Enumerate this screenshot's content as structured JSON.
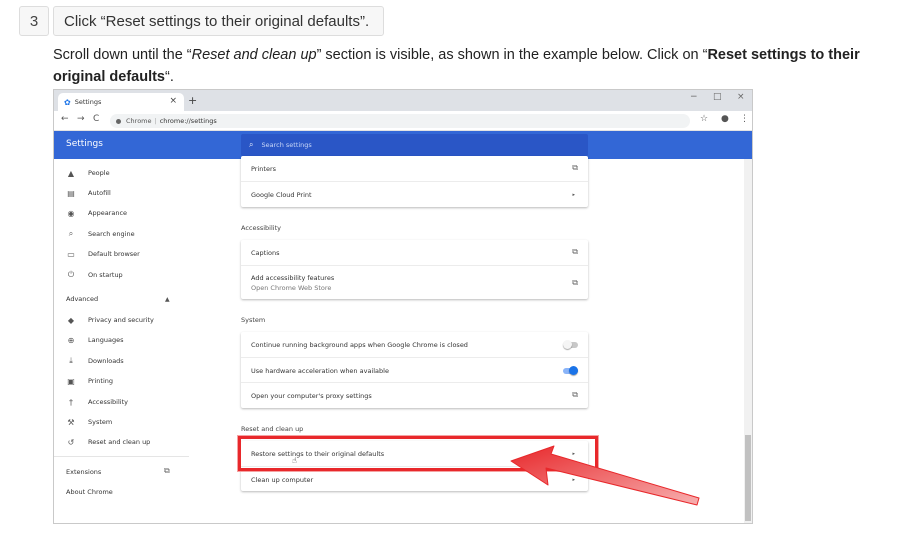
{
  "step": {
    "number": "3",
    "title": "Click “Reset settings to their original defaults”."
  },
  "instructions": {
    "part1": "Scroll down until the “",
    "em": "Reset and clean up",
    "part2": "” section is visible, as shown in the example below. Click on “",
    "strong": "Reset settings to their original defaults",
    "part3": "“."
  },
  "screenshot": {
    "tab": {
      "title": "Settings",
      "close": "×",
      "new_tab": "+"
    },
    "window_controls": {
      "minimize": "−",
      "maximize": "□",
      "close": "×"
    },
    "nav": {
      "back": "←",
      "forward": "→",
      "reload": "C"
    },
    "address": {
      "site": "Chrome",
      "path": "chrome://settings"
    },
    "toolbar_icons": {
      "bookmark": "☆",
      "profile": "●",
      "menu": "⋮"
    },
    "header": {
      "title": "Settings",
      "search_placeholder": "Search settings"
    },
    "sidebar": {
      "items": [
        {
          "icon": "person-icon",
          "glyph": "▲",
          "label": "People"
        },
        {
          "icon": "autofill-icon",
          "glyph": "▤",
          "label": "Autofill"
        },
        {
          "icon": "palette-icon",
          "glyph": "◉",
          "label": "Appearance"
        },
        {
          "icon": "search-icon",
          "glyph": "⌕",
          "label": "Search engine"
        },
        {
          "icon": "browser-icon",
          "glyph": "▭",
          "label": "Default browser"
        },
        {
          "icon": "power-icon",
          "glyph": "⏻",
          "label": "On startup"
        }
      ],
      "advanced_label": "Advanced",
      "advanced_chevron": "▲",
      "advanced_items": [
        {
          "icon": "shield-icon",
          "glyph": "◆",
          "label": "Privacy and security"
        },
        {
          "icon": "globe-icon",
          "glyph": "⊕",
          "label": "Languages"
        },
        {
          "icon": "download-icon",
          "glyph": "⤓",
          "label": "Downloads"
        },
        {
          "icon": "printer-icon",
          "glyph": "▣",
          "label": "Printing"
        },
        {
          "icon": "accessibility-icon",
          "glyph": "†",
          "label": "Accessibility"
        },
        {
          "icon": "wrench-icon",
          "glyph": "⚒",
          "label": "System"
        },
        {
          "icon": "history-icon",
          "glyph": "↺",
          "label": "Reset and clean up"
        }
      ],
      "extensions_label": "Extensions",
      "extensions_icon": "⧉",
      "about_label": "About Chrome"
    },
    "main": {
      "printing_rows": [
        {
          "label": "Printers",
          "action": "⧉"
        },
        {
          "label": "Google Cloud Print",
          "action": "▸"
        }
      ],
      "accessibility_title": "Accessibility",
      "accessibility_rows": [
        {
          "label": "Captions",
          "action": "⧉"
        },
        {
          "label": "Add accessibility features",
          "sublabel": "Open Chrome Web Store",
          "action": "⧉"
        }
      ],
      "system_title": "System",
      "system_rows": [
        {
          "label": "Continue running background apps when Google Chrome is closed",
          "toggle": false
        },
        {
          "label": "Use hardware acceleration when available",
          "toggle": true
        },
        {
          "label": "Open your computer's proxy settings",
          "action": "⧉"
        }
      ],
      "reset_title": "Reset and clean up",
      "reset_rows": [
        {
          "label": "Restore settings to their original defaults",
          "action": "▸"
        },
        {
          "label": "Clean up computer",
          "action": "▸"
        }
      ]
    },
    "colors": {
      "header": "#3367d6",
      "search": "#2a56c6",
      "toggle_on_track": "#8ab4f8",
      "toggle_on_knob": "#1a73e8",
      "highlight": "#e8282b",
      "arrow": "#e8282b"
    }
  }
}
